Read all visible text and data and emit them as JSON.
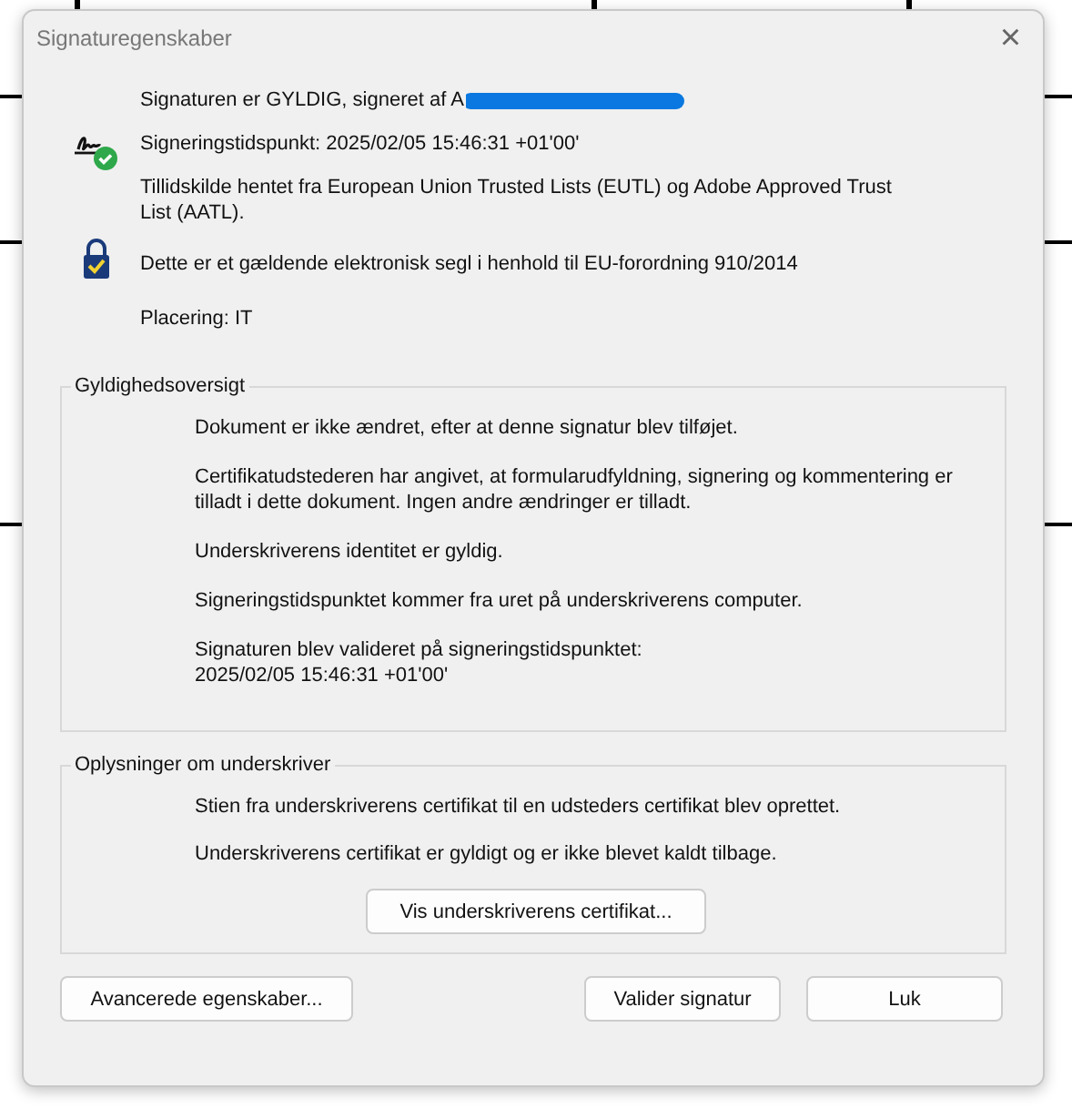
{
  "window": {
    "title": "Signaturegenskaber",
    "close": "×"
  },
  "summary": [
    {
      "kind": "signature",
      "lines": [
        "Signaturen er GYLDIG, signeret af A",
        "Signeringstidspunkt:  2025/02/05 15:46:31 +01'00'",
        "Tillidskilde hentet fra European Union Trusted Lists (EUTL) og Adobe Approved Trust List (AATL)."
      ],
      "redacted": true
    },
    {
      "kind": "seal",
      "lines": [
        "Dette er et gældende elektronisk segl i henhold til EU-forordning 910/2014"
      ]
    },
    {
      "kind": "plain",
      "lines": [
        "Placering:  IT"
      ]
    }
  ],
  "validity": {
    "title": "Gyldighedsoversigt",
    "items": [
      "Dokument er ikke ændret, efter at denne signatur blev tilføjet.",
      "Certifikatudstederen har angivet, at formularudfyldning, signering og kommentering er tilladt i dette dokument. Ingen andre ændringer er tilladt.",
      "Underskriverens identitet er gyldig.",
      "Signeringstidspunktet kommer fra uret på underskriverens computer.",
      "Signaturen blev valideret på signeringstidspunktet:\n2025/02/05 15:46:31 +01'00'"
    ]
  },
  "signer": {
    "title": "Oplysninger om underskriver",
    "items": [
      "Stien fra underskriverens certifikat til en udsteders certifikat blev oprettet.",
      "Underskriverens certifikat er gyldigt og er ikke blevet kaldt tilbage."
    ],
    "button": "Vis underskriverens certifikat..."
  },
  "buttons": [
    "Avancerede egenskaber...",
    "Valider signatur",
    "Luk"
  ]
}
